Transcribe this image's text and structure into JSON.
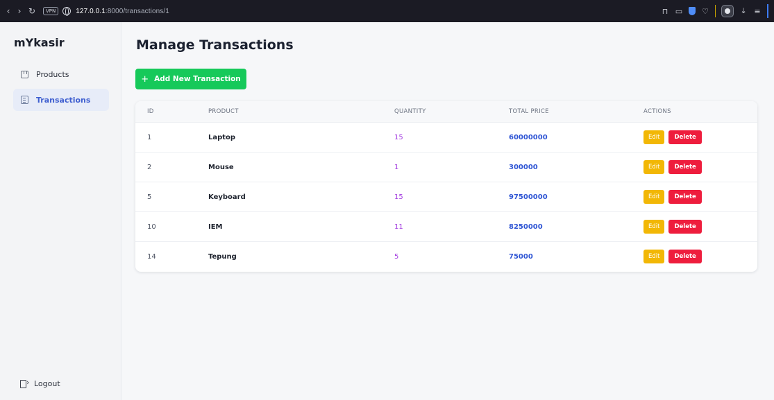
{
  "browser": {
    "vpn_label": "VPN",
    "url_host": "127.0.0.1",
    "url_path": ":8000/transactions/1"
  },
  "sidebar": {
    "brand": "mYkasir",
    "items": [
      {
        "label": "Products",
        "icon": "box-icon"
      },
      {
        "label": "Transactions",
        "icon": "transactions-icon",
        "active": true
      }
    ],
    "logout_label": "Logout"
  },
  "main": {
    "title": "Manage Transactions",
    "add_button_label": "Add New Transaction",
    "add_button_icon": "+"
  },
  "table": {
    "headers": [
      "ID",
      "PRODUCT",
      "QUANTITY",
      "TOTAL PRICE",
      "ACTIONS"
    ],
    "rows": [
      {
        "id": "1",
        "product": "Laptop",
        "quantity": "15",
        "total": "60000000"
      },
      {
        "id": "2",
        "product": "Mouse",
        "quantity": "1",
        "total": "300000"
      },
      {
        "id": "5",
        "product": "Keyboard",
        "quantity": "15",
        "total": "97500000"
      },
      {
        "id": "10",
        "product": "IEM",
        "quantity": "11",
        "total": "8250000"
      },
      {
        "id": "14",
        "product": "Tepung",
        "quantity": "5",
        "total": "75000"
      }
    ],
    "edit_label": "Edit",
    "delete_label": "Delete"
  },
  "colors": {
    "accent": "#3f5fd0",
    "add_button": "#16c95a",
    "edit_button": "#f2b705",
    "delete_button": "#ee1d3d",
    "quantity_text": "#a33be0",
    "total_text": "#2f55d4"
  }
}
